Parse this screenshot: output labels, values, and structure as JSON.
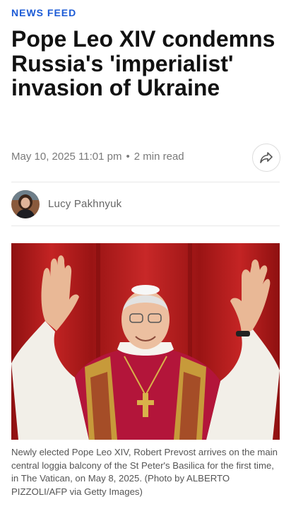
{
  "section": {
    "label": "NEWS FEED"
  },
  "article": {
    "headline": "Pope Leo XIV condemns Russia's 'imperialist' invasion of Ukraine",
    "date": "May 10, 2025 11:01 pm",
    "read_time": "2 min read",
    "separator": "•",
    "author": "Lucy Pakhnyuk",
    "image_caption": "Newly elected Pope Leo XIV, Robert Prevost arrives on the main central loggia balcony of the St Peter's Basilica for the first time, in The Vatican, on May 8, 2025. (Photo by ALBERTO PIZZOLI/AFP via Getty Images)"
  },
  "icons": {
    "share": "share-arrow-icon"
  },
  "colors": {
    "accent": "#1c5bd6",
    "headline": "#111111",
    "meta": "#7a7a7a",
    "caption": "#555555",
    "curtain": "#b01c1c"
  }
}
